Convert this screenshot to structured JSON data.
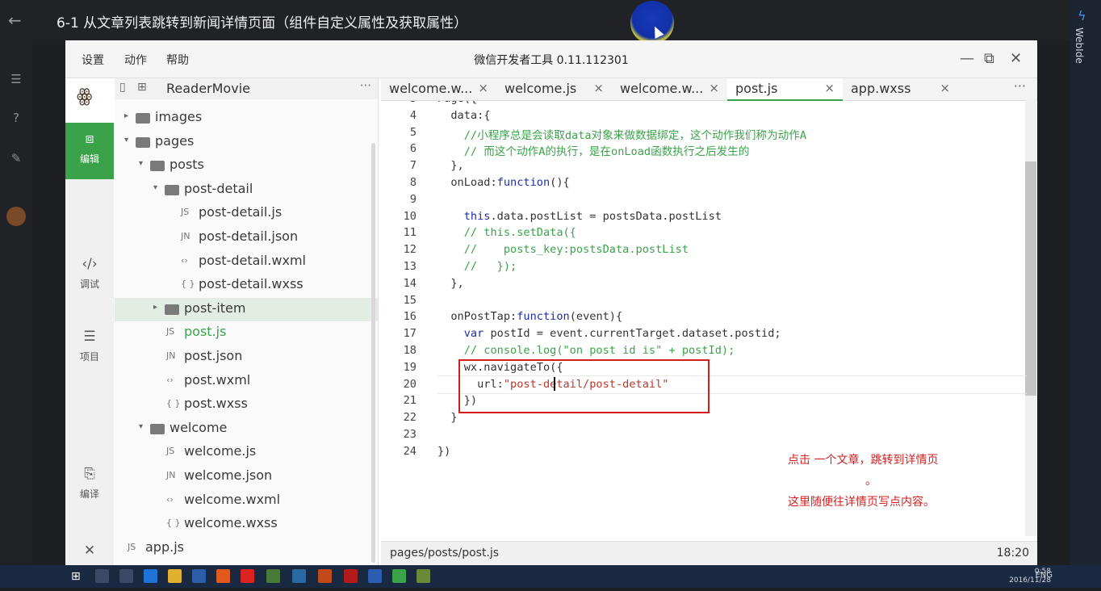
{
  "video": {
    "title": "6-1 从文章列表跳转到新闻详情页面（组件自定义属性及获取属性）",
    "back_icon": "arrow-left-icon"
  },
  "side_panel": {
    "label": "WebIde"
  },
  "app": {
    "menu": [
      "设置",
      "动作",
      "帮助"
    ],
    "title": "微信开发者工具 0.11.112301",
    "window_controls": {
      "minimize": "—",
      "maximize": "⧉",
      "close": "✕"
    }
  },
  "activity": [
    {
      "label": "编辑",
      "icon": "code-icon",
      "glyph": "⧈",
      "active": true
    },
    {
      "label": "调试",
      "icon": "debug-icon",
      "glyph": "‹/›",
      "active": false
    },
    {
      "label": "项目",
      "icon": "project-icon",
      "glyph": "☰",
      "active": false
    },
    {
      "label": "编译",
      "icon": "compile-icon",
      "glyph": "⎘",
      "active": false
    },
    {
      "label": "关闭",
      "icon": "close-icon",
      "glyph": "✕",
      "active": false
    }
  ],
  "tree": {
    "project": "ReaderMovie",
    "more": "···",
    "items": [
      {
        "name": "images",
        "kind": "folder",
        "caret": "▸"
      },
      {
        "name": "pages",
        "kind": "folder",
        "caret": "▾"
      },
      {
        "name": "posts",
        "kind": "folder",
        "caret": "▾"
      },
      {
        "name": "post-detail",
        "kind": "folder",
        "caret": "▾"
      },
      {
        "name": "post-detail.js",
        "kind": "file",
        "glyph": "JS"
      },
      {
        "name": "post-detail.json",
        "kind": "file",
        "glyph": "JN"
      },
      {
        "name": "post-detail.wxml",
        "kind": "file",
        "glyph": "‹›"
      },
      {
        "name": "post-detail.wxss",
        "kind": "file",
        "glyph": "{ }"
      },
      {
        "name": "post-item",
        "kind": "folder",
        "caret": "▸",
        "selected": true
      },
      {
        "name": "post.js",
        "kind": "file",
        "glyph": "JS",
        "active": true
      },
      {
        "name": "post.json",
        "kind": "file",
        "glyph": "JN"
      },
      {
        "name": "post.wxml",
        "kind": "file",
        "glyph": "‹›"
      },
      {
        "name": "post.wxss",
        "kind": "file",
        "glyph": "{ }"
      },
      {
        "name": "welcome",
        "kind": "folder",
        "caret": "▾"
      },
      {
        "name": "welcome.js",
        "kind": "file",
        "glyph": "JS"
      },
      {
        "name": "welcome.json",
        "kind": "file",
        "glyph": "JN"
      },
      {
        "name": "welcome.wxml",
        "kind": "file",
        "glyph": "‹›"
      },
      {
        "name": "welcome.wxss",
        "kind": "file",
        "glyph": "{ }"
      },
      {
        "name": "app.js",
        "kind": "file",
        "glyph": "JS"
      }
    ]
  },
  "tabs": [
    {
      "label": "welcome.w...",
      "close": "×"
    },
    {
      "label": "welcome.js",
      "close": "×"
    },
    {
      "label": "welcome.w...",
      "close": "×"
    },
    {
      "label": "post.js",
      "close": "×",
      "active": true
    },
    {
      "label": "app.wxss",
      "close": "×"
    }
  ],
  "tabs_more": "···",
  "code": [
    {
      "n": "3",
      "parts": [
        [
          "pl",
          "Page({"
        ]
      ]
    },
    {
      "n": "4",
      "parts": [
        [
          "pl",
          "  data:{"
        ]
      ]
    },
    {
      "n": "5",
      "parts": [
        [
          "cm",
          "    //小程序总是会读取data对象来做数据绑定，这个动作我们称为动作A"
        ]
      ]
    },
    {
      "n": "6",
      "parts": [
        [
          "cm",
          "    // 而这个动作A的执行，是在onLoad函数执行之后发生的"
        ]
      ]
    },
    {
      "n": "7",
      "parts": [
        [
          "pl",
          "  },"
        ]
      ]
    },
    {
      "n": "8",
      "parts": [
        [
          "pl",
          "  onLoad:"
        ],
        [
          "kw",
          "function"
        ],
        [
          "pl",
          "(){"
        ]
      ]
    },
    {
      "n": "9",
      "parts": [
        [
          "pl",
          ""
        ]
      ]
    },
    {
      "n": "10",
      "parts": [
        [
          "pl",
          "    "
        ],
        [
          "kw",
          "this"
        ],
        [
          "pl",
          ".data.postList = postsData.postList"
        ]
      ]
    },
    {
      "n": "11",
      "parts": [
        [
          "cm",
          "    // this.setData({"
        ]
      ]
    },
    {
      "n": "12",
      "parts": [
        [
          "cm",
          "    //    posts_key:postsData.postList"
        ]
      ]
    },
    {
      "n": "13",
      "parts": [
        [
          "cm",
          "    //   });"
        ]
      ]
    },
    {
      "n": "14",
      "parts": [
        [
          "pl",
          "  },"
        ]
      ]
    },
    {
      "n": "15",
      "parts": [
        [
          "pl",
          ""
        ]
      ]
    },
    {
      "n": "16",
      "parts": [
        [
          "pl",
          "  onPostTap:"
        ],
        [
          "kw",
          "function"
        ],
        [
          "pl",
          "(event){"
        ]
      ]
    },
    {
      "n": "17",
      "parts": [
        [
          "pl",
          "    "
        ],
        [
          "kw",
          "var"
        ],
        [
          "pl",
          " postId = event.currentTarget.dataset.postid;"
        ]
      ]
    },
    {
      "n": "18",
      "parts": [
        [
          "cm",
          "    // console.log(\"on post id is\" + postId);"
        ]
      ]
    },
    {
      "n": "19",
      "parts": [
        [
          "pl",
          "    wx.navigateTo({"
        ]
      ]
    },
    {
      "n": "20",
      "parts": [
        [
          "pl",
          "      url:"
        ],
        [
          "st",
          "\"post-detail/post-detail\""
        ]
      ]
    },
    {
      "n": "21",
      "parts": [
        [
          "pl",
          "    })"
        ]
      ]
    },
    {
      "n": "22",
      "parts": [
        [
          "pl",
          "  }"
        ]
      ]
    },
    {
      "n": "23",
      "parts": [
        [
          "pl",
          ""
        ]
      ]
    },
    {
      "n": "24",
      "parts": [
        [
          "pl",
          "})"
        ]
      ]
    }
  ],
  "annotation": {
    "line1": "点击 一个文章，跳转到详情页",
    "dot": "。",
    "line2": "这里随便往详情页写点内容。"
  },
  "status": {
    "path": "pages/posts/post.js",
    "position": "18:20"
  },
  "taskbar": {
    "tray": "ENG",
    "clock_time": "0:58",
    "clock_date": "2016/11/28"
  },
  "colors": {
    "accent": "#3aa34a",
    "highlight": "#d21d1d",
    "keyword": "#1c2ea8",
    "comment": "#3aa34a",
    "string": "#b8392d"
  }
}
